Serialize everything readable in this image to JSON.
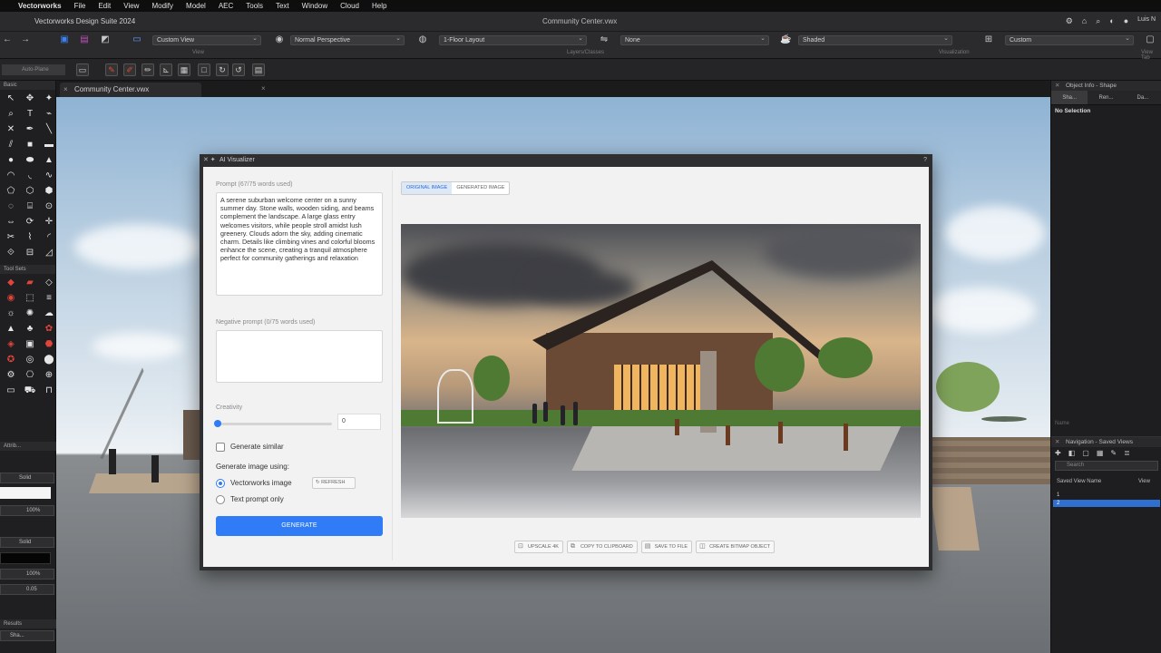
{
  "menubar": {
    "items": [
      "Vectorworks",
      "File",
      "Edit",
      "View",
      "Modify",
      "Model",
      "AEC",
      "Tools",
      "Text",
      "Window",
      "Cloud",
      "Help"
    ],
    "user": "Luis N"
  },
  "window": {
    "app_title": "Vectorworks Design Suite 2024",
    "doc_title": "Community Center.vwx"
  },
  "viewbar": {
    "saved_view": "Custom View",
    "projection": "Normal Perspective",
    "layer": "1-Floor Layout",
    "class": "None",
    "render_mode": "Shaded",
    "scale": "Custom",
    "captions": {
      "view": "View",
      "layers_classes": "Layers/Classes",
      "visualization": "Visualization",
      "view_tab": "View Tab"
    }
  },
  "modebar": {
    "auto_plane": "Auto-Plane"
  },
  "document_tab": {
    "label": "Community Center.vwx"
  },
  "palettes": {
    "basic": "Basic",
    "tool_sets": "Tool Sets",
    "attributes": "Attrib...",
    "snaps": "Snap...",
    "solid1": "Solid",
    "solid2": "Solid",
    "opacity1": "100%",
    "opacity2": "100%",
    "thickness": "0.05",
    "results": "Results",
    "shape": "Sha..."
  },
  "dialog": {
    "title": "AI Visualizer",
    "help": "?",
    "prompt_label": "Prompt (67/75 words used)",
    "prompt_text": "A serene suburban welcome center on a sunny summer day. Stone walls, wooden siding, and beams complement the landscape. A large glass entry welcomes visitors, while people stroll amidst lush greenery. Clouds adorn the sky, adding cinematic charm. Details like climbing vines and colorful blooms enhance the scene, creating a tranquil atmosphere perfect for community gatherings and relaxation",
    "negative_label": "Negative prompt (0/75 words used)",
    "creativity_label": "Creativity",
    "creativity_value": "0",
    "creativity_level": 0,
    "generate_similar": "Generate similar",
    "generate_using_label": "Generate image using:",
    "option_vectorworks": "Vectorworks image",
    "refresh": "REFRESH",
    "option_text": "Text prompt only",
    "generate_button": "GENERATE",
    "tab_original": "ORIGINAL IMAGE",
    "tab_generated": "GENERATED IMAGE",
    "actions": [
      {
        "icon": "upscale-icon",
        "label": "UPSCALE 4K"
      },
      {
        "icon": "copy-icon",
        "label": "COPY TO CLIPBOARD"
      },
      {
        "icon": "save-icon",
        "label": "SAVE TO FILE"
      },
      {
        "icon": "bitmap-icon",
        "label": "CREATE BITMAP OBJECT"
      }
    ]
  },
  "object_info": {
    "title": "Object Info - Shape",
    "tabs": [
      "Sha...",
      "Ren...",
      "Da..."
    ],
    "selection": "No Selection"
  },
  "navigation": {
    "title": "Navigation - Saved Views",
    "search_placeholder": "Search",
    "column_name": "Saved View Name",
    "column_view": "View",
    "rows": [
      "1",
      "2"
    ],
    "palette_name": "Name"
  },
  "colors": {
    "accent": "#2f7cf6",
    "app_bg": "#1c1c1e",
    "dialog_bg": "#f2f2f3"
  }
}
